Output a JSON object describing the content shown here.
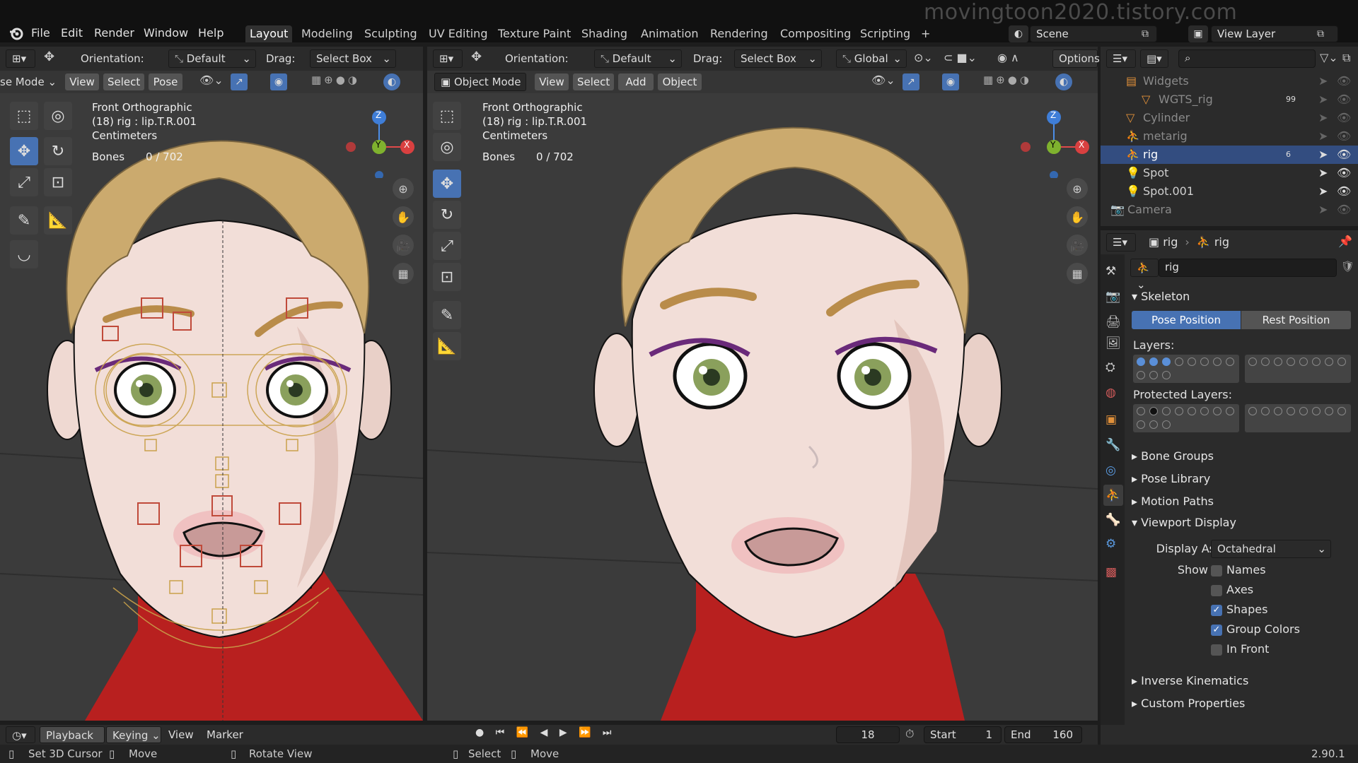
{
  "watermark": "movingtoon2020.tistory.com",
  "menu": [
    "File",
    "Edit",
    "Render",
    "Window",
    "Help"
  ],
  "workspaces": [
    "Layout",
    "Modeling",
    "Sculpting",
    "UV Editing",
    "Texture Paint",
    "Shading",
    "Animation",
    "Rendering",
    "Compositing",
    "Scripting"
  ],
  "workspaces_plus": "+",
  "scene": "Scene",
  "view_layer": "View Layer",
  "left_vp": {
    "orientation_label": "Orientation:",
    "orientation": "Default",
    "drag_label": "Drag:",
    "drag": "Select Box",
    "mode": "se Mode",
    "view": "View",
    "select": "Select",
    "pose": "Pose",
    "overlay": [
      "Front Orthographic",
      "(18) rig : lip.T.R.001",
      "Centimeters"
    ],
    "bones_label": "Bones",
    "bones_value": "0 / 702"
  },
  "right_vp": {
    "orientation_label": "Orientation:",
    "orientation": "Default",
    "drag_label": "Drag:",
    "drag": "Select Box",
    "transform": "Global",
    "options": "Options",
    "mode": "Object Mode",
    "view": "View",
    "select": "Select",
    "add": "Add",
    "object": "Object",
    "overlay": [
      "Front Orthographic",
      "(18) rig : lip.T.R.001",
      "Centimeters"
    ],
    "bones_label": "Bones",
    "bones_value": "0 / 702"
  },
  "axes": {
    "z": "Z",
    "y": "Y",
    "x": "X"
  },
  "outliner": [
    {
      "name": "Widgets",
      "indent": 0,
      "dim": true
    },
    {
      "name": "WGTS_rig",
      "indent": 1,
      "dim": true,
      "badge": "99"
    },
    {
      "name": "Cylinder",
      "indent": 0,
      "dim": true
    },
    {
      "name": "metarig",
      "indent": 0,
      "dim": true
    },
    {
      "name": "rig",
      "indent": 0,
      "selected": true,
      "badge": "6"
    },
    {
      "name": "Spot",
      "indent": 0
    },
    {
      "name": "Spot.001",
      "indent": 0
    },
    {
      "name": "Camera",
      "indent": -1,
      "dim": true
    }
  ],
  "props": {
    "breadcrumb_a": "rig",
    "breadcrumb_b": "rig",
    "name_field": "rig",
    "skeleton": "Skeleton",
    "pose_position": "Pose Position",
    "rest_position": "Rest Position",
    "layers": "Layers:",
    "protected_layers": "Protected Layers:",
    "bone_groups": "Bone Groups",
    "pose_library": "Pose Library",
    "motion_paths": "Motion Paths",
    "viewport_display": "Viewport Display",
    "display_as_label": "Display As",
    "display_as": "Octahedral",
    "show_label": "Show",
    "names": "Names",
    "axes": "Axes",
    "shapes": "Shapes",
    "group_colors": "Group Colors",
    "in_front": "In Front",
    "inverse_kinematics": "Inverse Kinematics",
    "custom_properties": "Custom Properties"
  },
  "timeline": {
    "playback": "Playback",
    "keying": "Keying",
    "view": "View",
    "marker": "Marker",
    "frame": "18",
    "start_label": "Start",
    "start": "1",
    "end_label": "End",
    "end": "160"
  },
  "status": {
    "set_cursor": "Set 3D Cursor",
    "move": "Move",
    "rotate": "Rotate View",
    "select": "Select",
    "move2": "Move",
    "version": "2.90.1"
  },
  "colors": {
    "accent": "#4772b3",
    "header": "#2b2b2b",
    "viewport": "#3b3b3b",
    "skin": "#f0dcd6",
    "hair": "#cbaa6e",
    "shirt": "#b8201f"
  }
}
